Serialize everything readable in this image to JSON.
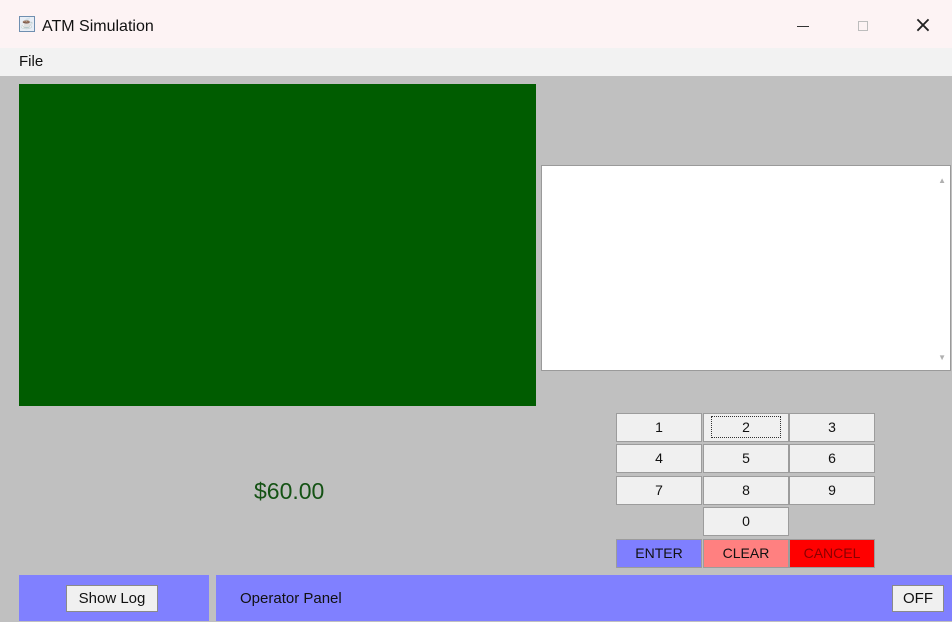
{
  "window": {
    "title": "ATM Simulation",
    "icon": "java-cup-icon",
    "controls": {
      "minimize": "minimize-icon",
      "maximize": "maximize-icon",
      "close": "close-icon"
    }
  },
  "menu": {
    "file": "File"
  },
  "receipt": {
    "text": ""
  },
  "display": {
    "cash": "$60.00"
  },
  "keypad": {
    "digits": [
      "1",
      "2",
      "3",
      "4",
      "5",
      "6",
      "7",
      "8",
      "9",
      "0"
    ],
    "enter": "ENTER",
    "clear": "CLEAR",
    "cancel": "CANCEL",
    "focused_key": "2"
  },
  "bottom": {
    "show_log": "Show Log",
    "operator_panel": "Operator Panel",
    "off": "OFF"
  },
  "colors": {
    "screen": "#005c00",
    "panel": "#c0c0c0",
    "operator_bar": "#8080ff",
    "enter": "#7f7fff",
    "clear": "#ff8080",
    "cancel": "#ff0000",
    "cash_text": "#145214"
  }
}
